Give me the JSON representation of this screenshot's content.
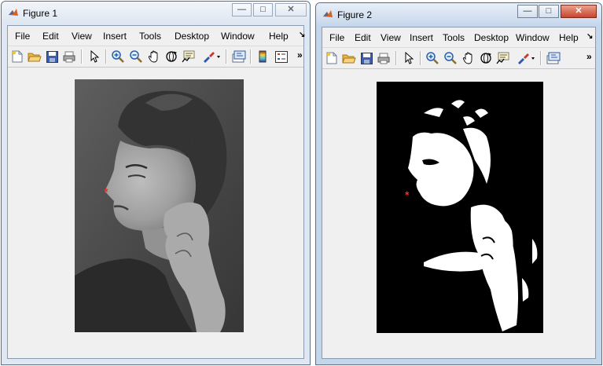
{
  "figure1": {
    "title": "Figure 1",
    "controls": {
      "minimize": "—",
      "maximize": "□",
      "close": "✕"
    },
    "menu": [
      "File",
      "Edit",
      "View",
      "Insert",
      "Tools",
      "Desktop",
      "Window",
      "Help"
    ],
    "menu_more": "↘",
    "toolbar_more": "»",
    "toolbar_icons": [
      "new-figure-icon",
      "open-file-icon",
      "save-icon",
      "print-icon",
      "pointer-icon",
      "zoom-in-icon",
      "zoom-out-icon",
      "pan-icon",
      "rotate-icon",
      "data-cursor-icon",
      "brush-icon",
      "link-icon",
      "colorbar-icon",
      "legend-icon"
    ],
    "image": "grayscale portrait with red marker"
  },
  "figure2": {
    "title": "Figure 2",
    "controls": {
      "minimize": "—",
      "maximize": "□",
      "close": "✕"
    },
    "menu": [
      "File",
      "Edit",
      "View",
      "Insert",
      "Tools",
      "Desktop",
      "Window",
      "Help"
    ],
    "menu_more": "↘",
    "toolbar_more": "»",
    "toolbar_icons": [
      "new-figure-icon",
      "open-file-icon",
      "save-icon",
      "print-icon",
      "pointer-icon",
      "zoom-in-icon",
      "zoom-out-icon",
      "pan-icon",
      "rotate-icon",
      "data-cursor-icon",
      "brush-icon",
      "link-icon"
    ],
    "image": "binary thresholded portrait with red marker"
  },
  "colors": {
    "marker": "#ff2020",
    "titlebar_active": "#c6d7ec",
    "client": "#f0f0f0"
  }
}
